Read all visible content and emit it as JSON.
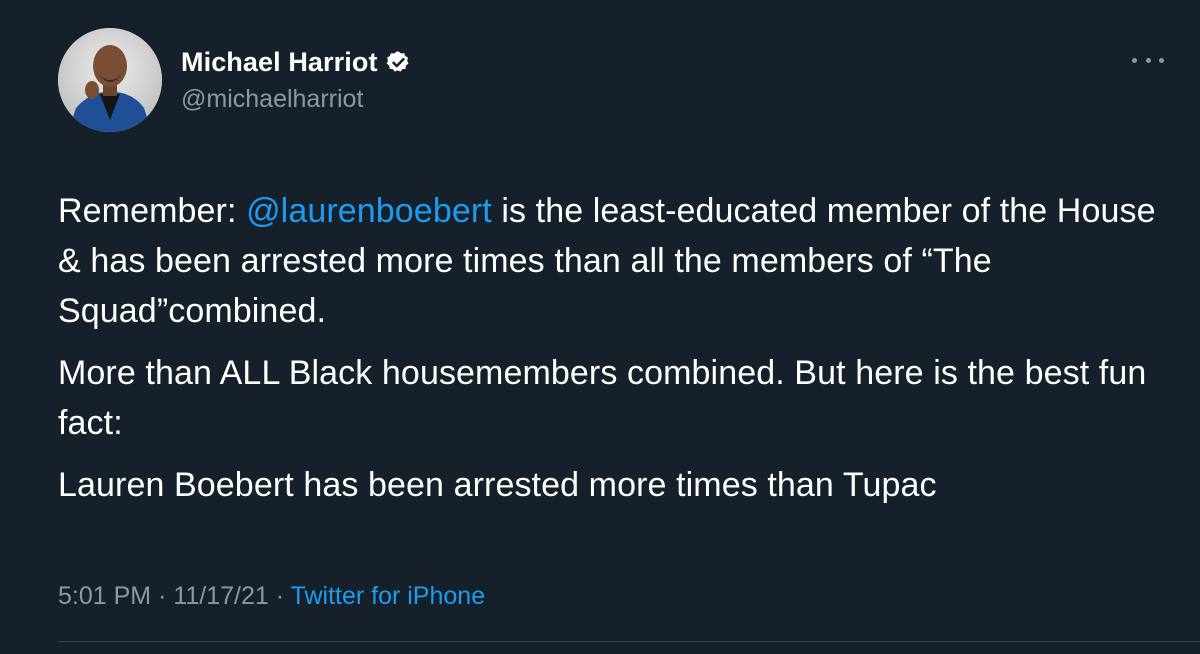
{
  "author": {
    "display_name": "Michael Harriot",
    "handle": "@michaelharriot",
    "verified_icon": "verified-badge-icon"
  },
  "tweet": {
    "paragraph1": {
      "prefix": "Remember: ",
      "mention": "@laurenboebert",
      "suffix": " is the least-educated member of the House & has been arrested more times than all the members of “The Squad”combined."
    },
    "paragraph2": "More than ALL Black housemembers combined. But here is the best fun fact:",
    "paragraph3": "Lauren Boebert has been arrested more times than Tupac"
  },
  "meta": {
    "time": "5:01 PM",
    "separator": " · ",
    "date": "11/17/21",
    "source": "Twitter for iPhone"
  },
  "colors": {
    "background": "#15202b",
    "link": "#1d9bf0",
    "secondary_text": "#8b98a5"
  }
}
